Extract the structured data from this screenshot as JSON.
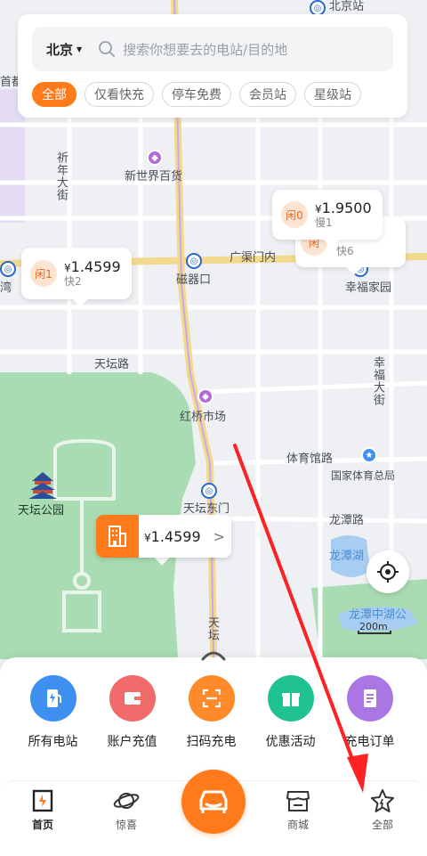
{
  "search": {
    "city": "北京",
    "placeholder": "搜索你想要去的电站/目的地"
  },
  "filters": [
    {
      "label": "全部",
      "active": true
    },
    {
      "label": "仅看快充",
      "active": false
    },
    {
      "label": "停车免费",
      "active": false
    },
    {
      "label": "会员站",
      "active": false
    },
    {
      "label": "星级站",
      "active": false
    }
  ],
  "map": {
    "labels": {
      "beijing_station": "北京站",
      "shoudu": "首都",
      "xinyuan_street": "祈年大街",
      "new_world": "新世界百货",
      "guangqumen": "广渠门内",
      "cishikou": "磁器口",
      "xingfu_home": "幸福家园",
      "tiantan_road": "天坛路",
      "hongqiao": "红桥市场",
      "xingfu_street": "幸福大街",
      "tiyuguan_road": "体育馆路",
      "national_sport": "国家体育总局",
      "temple_of_heaven": "天坛公园",
      "tiantan_east_gate": "天坛东门",
      "longtan_road": "龙潭路",
      "longtan_lake": "龙潭湖",
      "longtan_zhonghu": "龙潭中湖公",
      "tian": "天坛",
      "wan": "湾"
    },
    "scale": "200m"
  },
  "stations": [
    {
      "tag": "闲1",
      "currency": "¥",
      "price": "1.4599",
      "sub": "快2"
    },
    {
      "tag": "闲0",
      "currency": "¥",
      "price": "1.9500",
      "sub": "慢1"
    },
    {
      "tag": "闲",
      "currency": "",
      "price": "",
      "sub": "快6"
    }
  ],
  "featured_station": {
    "currency": "¥",
    "price": "1.4599",
    "chevron": ">"
  },
  "actions": [
    {
      "label": "所有电站",
      "color": "#3d8ff0"
    },
    {
      "label": "账户充值",
      "color": "#f26b6b"
    },
    {
      "label": "扫码充电",
      "color": "#ff8a2a"
    },
    {
      "label": "优惠活动",
      "color": "#1fc391"
    },
    {
      "label": "充电订单",
      "color": "#a976e4"
    }
  ],
  "nav": {
    "home": "首页",
    "surprise": "惊喜",
    "mall": "商城",
    "all": "全部"
  },
  "colors": {
    "accent": "#ff7a1a",
    "annotation": "#ff2222"
  }
}
